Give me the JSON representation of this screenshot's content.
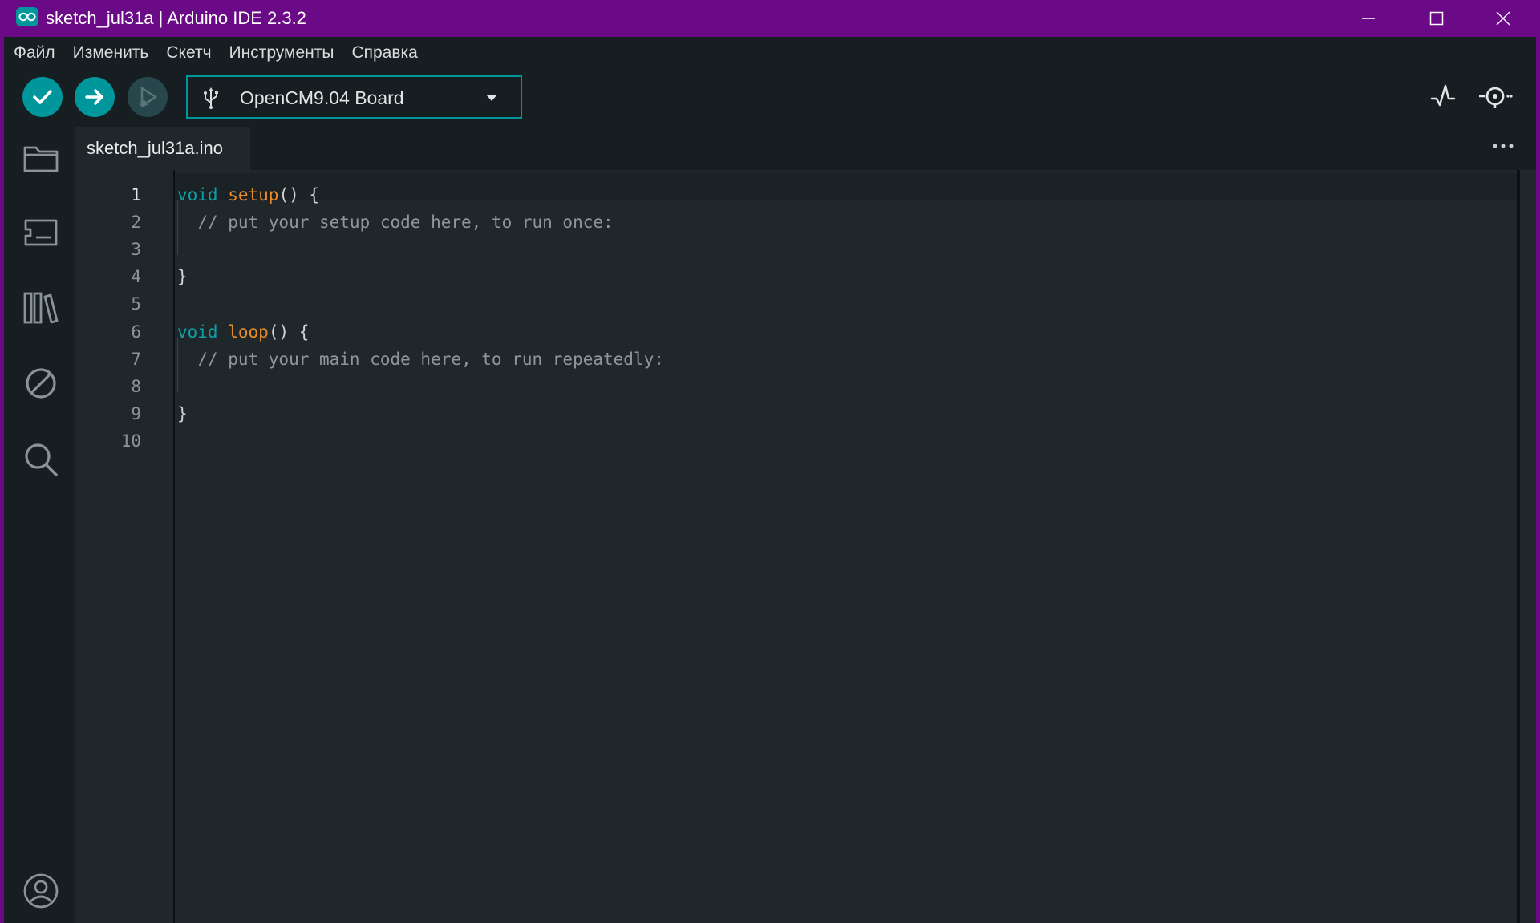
{
  "window": {
    "title": "sketch_jul31a | Arduino IDE 2.3.2",
    "accent": "#00979c",
    "titlebar_color": "#6b0a86"
  },
  "menu": {
    "items": [
      "Файл",
      "Изменить",
      "Скетч",
      "Инструменты",
      "Справка"
    ]
  },
  "toolbar": {
    "verify_icon": "check-icon",
    "upload_icon": "arrow-right-icon",
    "debug_icon": "debug-icon",
    "board": "OpenCM9.04 Board",
    "plotter_icon": "serial-plotter-icon",
    "monitor_icon": "serial-monitor-icon"
  },
  "sidebar": {
    "icons": [
      "folder-icon",
      "boards-manager-icon",
      "library-manager-icon",
      "debug-disabled-icon",
      "search-icon",
      "account-icon"
    ]
  },
  "editor": {
    "tab": "sketch_jul31a.ino",
    "line_numbers": [
      "1",
      "2",
      "3",
      "4",
      "5",
      "6",
      "7",
      "8",
      "9",
      "10"
    ],
    "code": {
      "l1_kw": "void",
      "l1_fn": "setup",
      "l1_rest": "() {",
      "l2_comment": "  // put your setup code here, to run once:",
      "l4": "}",
      "l6_kw": "void",
      "l6_fn": "loop",
      "l6_rest": "() {",
      "l7_comment": "  // put your main code here, to run repeatedly:",
      "l9": "}"
    }
  }
}
